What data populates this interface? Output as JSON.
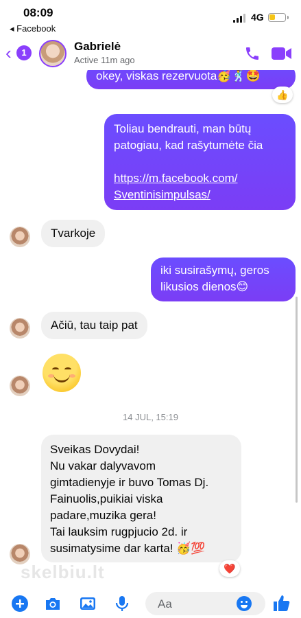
{
  "status": {
    "time": "08:09",
    "back_app": "◂ Facebook",
    "network": "4G"
  },
  "header": {
    "back_count": "1",
    "name": "Gabrielė",
    "active": "Active 11m ago"
  },
  "messages": {
    "m1": "okey, viskas rezervuota🥳🕺🤩",
    "m1_reaction": "👍",
    "m2_line1": "Toliau bendrauti, man būtų",
    "m2_line2": "patogiau, kad rašytumėte čia",
    "m2_link1": "https://m.facebook.com/",
    "m2_link2": "Sventinisimpulsas/",
    "m3": "Tvarkoje",
    "m4_line1": "iki susirašymų, geros",
    "m4_line2": "likusios dienos😊",
    "m5": "Ačiū, tau taip pat",
    "timestamp": "14 JUL, 15:19",
    "m6_lines": [
      "Sveikas Dovydai!",
      "Nu vakar dalyvavom",
      "gimtadienyje ir buvo Tomas Dj.",
      "Fainuolis,puikiai viska",
      "padare,muzika gera!",
      "Tai lauksim rugpjucio 2d. ir",
      "susimatysime dar karta! 🥳💯"
    ],
    "m6_reaction": "❤️"
  },
  "watermark": "skelbiu.lt",
  "composer": {
    "placeholder": "Aa"
  },
  "colors": {
    "accent": "#8a3ffc",
    "outgoing": "#7b3df5",
    "incoming": "#f0f0f0",
    "composer_icons": "#1877f2"
  },
  "icons": [
    "call-icon",
    "video-icon",
    "plus-icon",
    "camera-icon",
    "image-icon",
    "mic-icon",
    "emoji-icon",
    "like-icon"
  ]
}
